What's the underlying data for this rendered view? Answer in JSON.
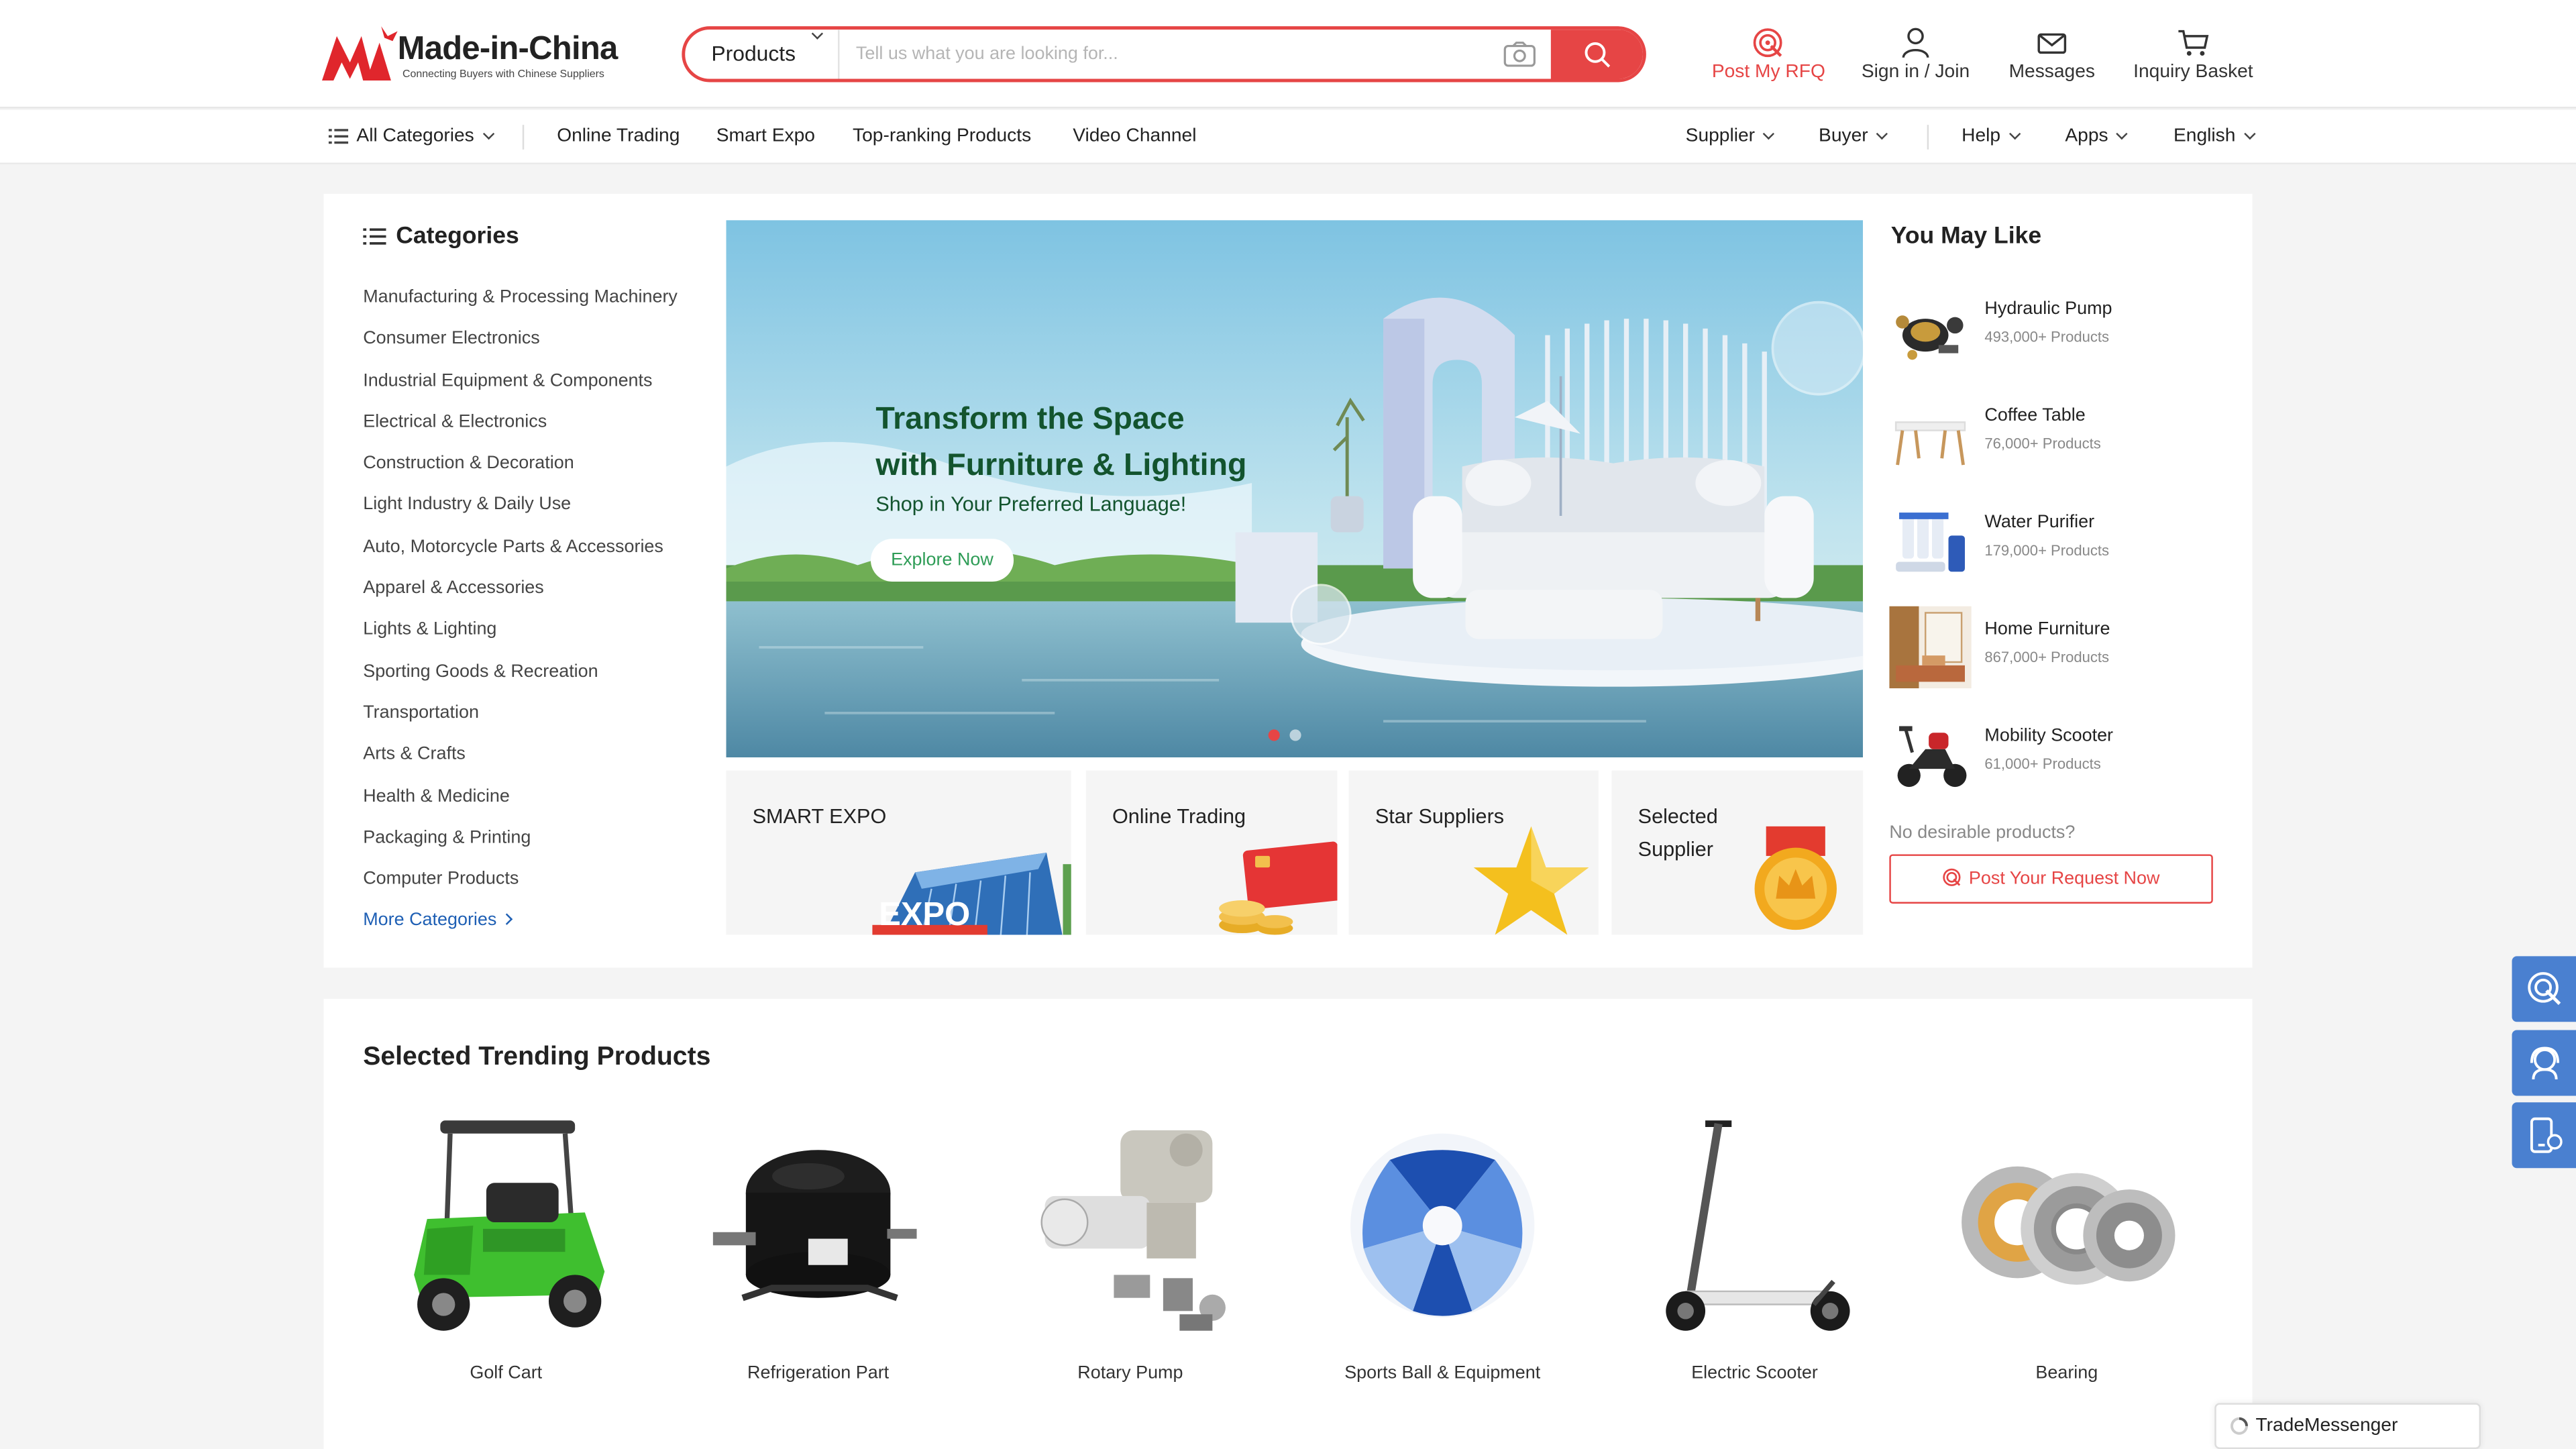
{
  "brand": {
    "name": "Made-in-China",
    "tagline": "Connecting Buyers with Chinese Suppliers",
    "accent": "#e64545",
    "link_color": "#1e5fb4"
  },
  "search": {
    "category": "Products",
    "placeholder": "Tell us what you are looking for..."
  },
  "header_actions": {
    "rfq": "Post My RFQ",
    "signin": "Sign in / Join",
    "messages": "Messages",
    "basket": "Inquiry Basket"
  },
  "nav": {
    "all_categories": "All Categories",
    "links": [
      "Online Trading",
      "Smart Expo",
      "Top-ranking Products",
      "Video Channel"
    ],
    "supplier": "Supplier",
    "buyer": "Buyer",
    "help": "Help",
    "apps": "Apps",
    "language": "English"
  },
  "categories": {
    "title": "Categories",
    "items": [
      "Manufacturing & Processing Machinery",
      "Consumer Electronics",
      "Industrial Equipment & Components",
      "Electrical & Electronics",
      "Construction & Decoration",
      "Light Industry & Daily Use",
      "Auto, Motorcycle Parts & Accessories",
      "Apparel & Accessories",
      "Lights & Lighting",
      "Sporting Goods & Recreation",
      "Transportation",
      "Arts & Crafts",
      "Health & Medicine",
      "Packaging & Printing",
      "Computer Products"
    ],
    "more": "More Categories"
  },
  "banner": {
    "line1": "Transform the Space",
    "line2": "with Furniture & Lighting",
    "subtitle": "Shop in Your Preferred Language!",
    "button": "Explore Now"
  },
  "tiles": {
    "expo": "SMART EXPO",
    "expo_img_text": "EXPO",
    "trading": "Online Trading",
    "star": "Star Suppliers",
    "selected_line1": "Selected",
    "selected_line2": "Supplier"
  },
  "you_may_like": {
    "title": "You May Like",
    "items": [
      {
        "name": "Hydraulic Pump",
        "count": "493,000+ Products"
      },
      {
        "name": "Coffee Table",
        "count": "76,000+ Products"
      },
      {
        "name": "Water Purifier",
        "count": "179,000+ Products"
      },
      {
        "name": "Home Furniture",
        "count": "867,000+ Products"
      },
      {
        "name": "Mobility Scooter",
        "count": "61,000+ Products"
      }
    ],
    "no_desirable": "No desirable products?",
    "post_request": "Post Your Request Now"
  },
  "trending": {
    "title": "Selected Trending Products",
    "items": [
      "Golf Cart",
      "Refrigeration Part",
      "Rotary Pump",
      "Sports Ball & Equipment",
      "Electric Scooter",
      "Bearing"
    ]
  },
  "trade_messenger": "TradeMessenger",
  "icons": [
    "search-icon",
    "camera-icon",
    "rfq-icon",
    "user-icon",
    "mail-icon",
    "cart-icon",
    "list-icon",
    "chevron-down-icon",
    "chevron-right-icon"
  ]
}
